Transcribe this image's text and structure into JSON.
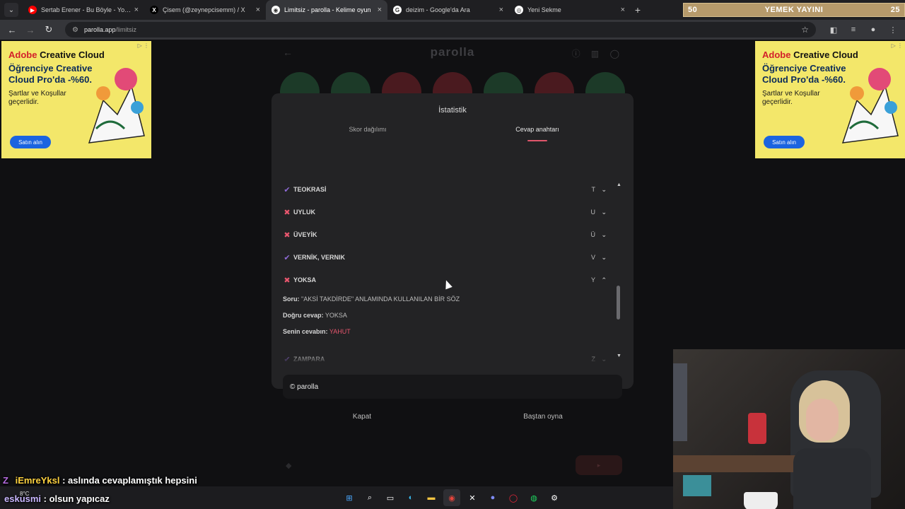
{
  "browser": {
    "tabs": [
      {
        "title": "Sertab Erener - Bu Böyle - YouT",
        "icon": "youtube-icon",
        "color": "#ff0000",
        "glyph": "▶"
      },
      {
        "title": "Çisem (@zeynepcisemm) / X",
        "icon": "x-icon",
        "color": "#000000",
        "glyph": "X"
      },
      {
        "title": "Limitsiz - parolla - Kelime oyun",
        "icon": "parolla-icon",
        "color": "#ffffff",
        "glyph": "◉",
        "active": true
      },
      {
        "title": "deizim - Google'da Ara",
        "icon": "google-icon",
        "color": "#ffffff",
        "glyph": "G"
      },
      {
        "title": "Yeni Sekme",
        "icon": "chrome-icon",
        "color": "#ffffff",
        "glyph": "◎"
      }
    ],
    "new_tab": "+",
    "url_host": "parolla.app",
    "url_path": "/limitsiz"
  },
  "stream_banner": {
    "left": "50",
    "center": "YEMEK YAYINI",
    "right": "25"
  },
  "ad": {
    "brand_red": "Adobe",
    "brand": " Creative Cloud",
    "headline": "Öğrenciye Creative Cloud Pro'da -%60.",
    "terms": "Şartlar ve Koşullar geçerlidir.",
    "cta": "Satın alın"
  },
  "game": {
    "logo": "parolla"
  },
  "modal": {
    "title": "İstatistik",
    "tabs": [
      "Skor dağılımı",
      "Cevap anahtarı"
    ],
    "rows": [
      {
        "word": "TEOKRASİ",
        "letter": "T",
        "status": "correct",
        "chevron": "⌄"
      },
      {
        "word": "UYLUK",
        "letter": "U",
        "status": "wrong",
        "chevron": "⌄"
      },
      {
        "word": "ÜVEYİK",
        "letter": "Ü",
        "status": "wrong",
        "chevron": "⌄"
      },
      {
        "word": "VERNİK, VERNIK",
        "letter": "V",
        "status": "correct",
        "chevron": "⌄"
      },
      {
        "word": "YOKSA",
        "letter": "Y",
        "status": "wrong",
        "chevron": "⌃"
      },
      {
        "word": "ZAMPARA",
        "letter": "Z",
        "status": "correct",
        "chevron": "⌄"
      }
    ],
    "detail": {
      "question_label": "Soru:",
      "question": "\"AKSİ TAKDİRDE\" ANLAMINDA KULLANILAN BİR SÖZ",
      "answer_label": "Doğru cevap:",
      "answer": "YOKSA",
      "yours_label": "Senin cevabın:",
      "yours": "YAHUT"
    },
    "footer_brand": "© parolla",
    "close": "Kapat",
    "restart": "Baştan oyna"
  },
  "chat": [
    {
      "user": "iEmreYksl",
      "message": ": aslında cevaplamıştık hepsini"
    },
    {
      "user": "eskusmi",
      "message": ": olsun yapıcaz"
    }
  ],
  "taskbar": {
    "weather": "8°C"
  },
  "colors": {
    "accent": "#e0566b",
    "correct": "#8e6ad6",
    "wrong": "#e8566e"
  }
}
